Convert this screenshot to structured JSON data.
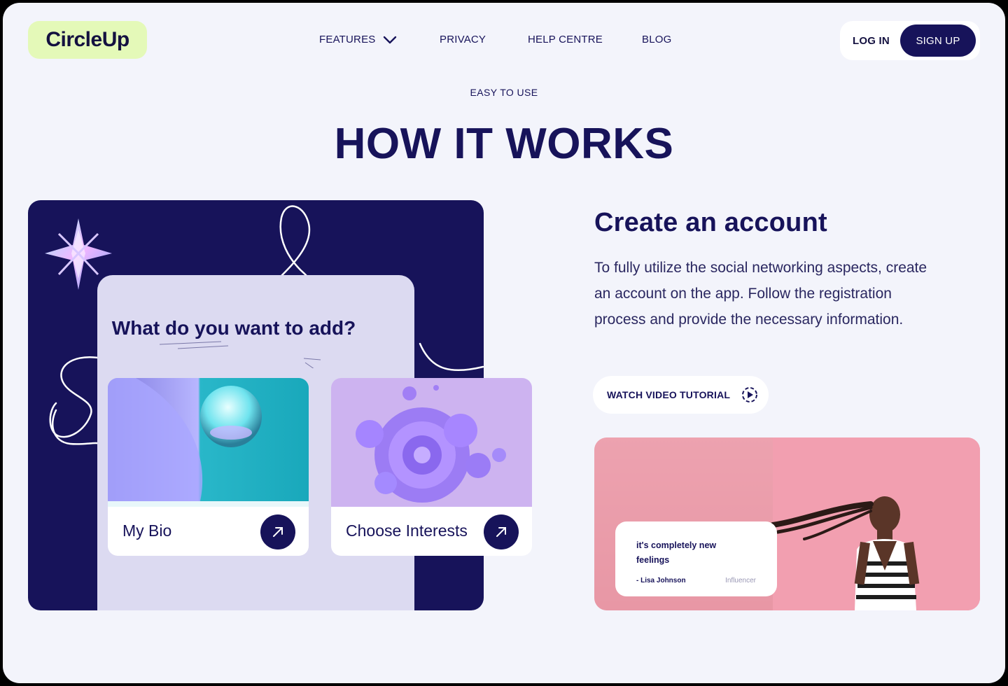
{
  "brand": {
    "name": "CircleUp"
  },
  "nav": {
    "items": [
      {
        "label": "FEATURES",
        "has_dropdown": true,
        "icon": "chevron-down-icon"
      },
      {
        "label": "PRIVACY"
      },
      {
        "label": "HELP CENTRE"
      },
      {
        "label": "BLOG"
      }
    ]
  },
  "auth": {
    "login_label": "LOG IN",
    "signup_label": "SIGN UP"
  },
  "section": {
    "eyebrow": "EASY TO USE",
    "title": "HOW IT WORKS"
  },
  "card": {
    "question": "What do you want to add?",
    "choices": [
      {
        "label": "My Bio",
        "icon": "arrow-up-right-icon",
        "image": "water-droplet-render"
      },
      {
        "label": "Choose Interests",
        "icon": "arrow-up-right-icon",
        "image": "purple-blob-render"
      }
    ],
    "decor": {
      "star": "crystal-star-icon"
    }
  },
  "step": {
    "title": "Create an account",
    "description": "To fully utilize the social networking  aspects, create an account on the app. Follow the registration process and provide the necessary information.",
    "cta_label": "WATCH VIDEO TUTORIAL",
    "cta_icon": "play-circle-icon"
  },
  "testimonial": {
    "quote": "it's completely new feelings",
    "author": "- Lisa Johnson",
    "role": "Influencer"
  },
  "colors": {
    "navy": "#17135a",
    "background": "#f3f4fb",
    "logo_bg": "#e4f9b8",
    "sheet": "#dcdaf1",
    "photo_pink": "#ee9aa8"
  }
}
